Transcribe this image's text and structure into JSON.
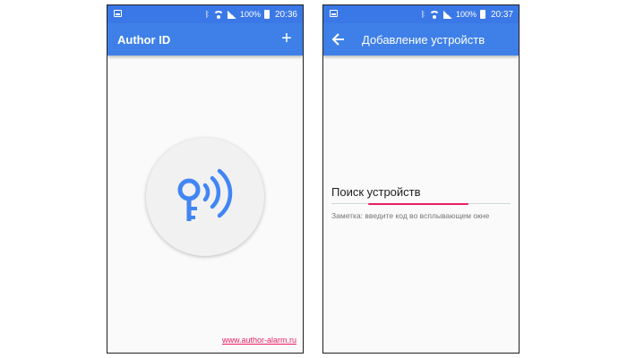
{
  "left_screen": {
    "status": {
      "battery": "100%",
      "time": "20:36"
    },
    "appbar": {
      "title": "Author ID",
      "add_label": "+"
    },
    "footer_link": "www.author-alarm.ru"
  },
  "right_screen": {
    "status": {
      "battery": "100%",
      "time": "20:37"
    },
    "appbar": {
      "title": "Добавление устройств"
    },
    "search": {
      "title": "Поиск устройств",
      "note": "Заметка: введите код во всплывающем окне"
    }
  },
  "colors": {
    "primary": "#3f80e8",
    "status_bar": "#3b78e7",
    "accent": "#e91e63",
    "icon": "#4285f4"
  },
  "icons": [
    "notification-icon",
    "image-icon",
    "bluetooth-icon",
    "wifi-icon",
    "signal-icon",
    "battery-icon",
    "add-icon",
    "back-arrow-icon",
    "key-wireless-icon"
  ]
}
